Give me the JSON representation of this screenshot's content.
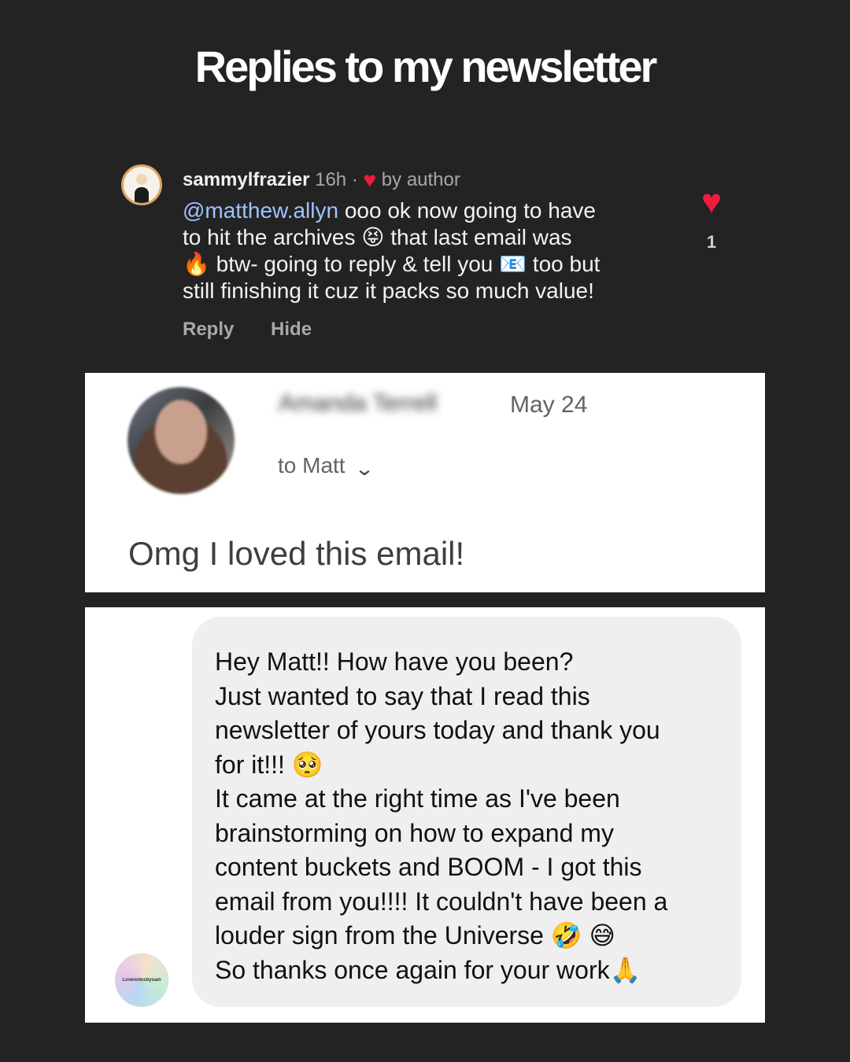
{
  "title": "Replies to my newsletter",
  "instagram_comment": {
    "username": "sammylfrazier",
    "time": "16h",
    "separator": "·",
    "liked_by_author": "by author",
    "mention": "@matthew.allyn",
    "text_lines": [
      " ooo ok now going to have",
      "to hit the archives 😝 that last email was",
      "🔥 btw- going to reply & tell you 📧 too but",
      "still finishing it cuz it packs so much value!"
    ],
    "reply_label": "Reply",
    "hide_label": "Hide",
    "like_count": "1",
    "heart_color": "#ed1c3e"
  },
  "email": {
    "sender_name": "Amanda Terrell",
    "date": "May 24",
    "to": "to Matt",
    "body": "Omg I loved this email!"
  },
  "dm": {
    "avatar_label": "Lovenotesbysam",
    "lines": [
      "Hey Matt!! How have you been?",
      "Just wanted to say that I read this",
      "newsletter of yours today and thank you",
      "for it!!! 🥺",
      "It came at the right time as I've been",
      "brainstorming on how to expand my",
      "content buckets and BOOM - I got this",
      "email from you!!!! It couldn't have been a",
      "louder sign from the Universe 🤣 😅",
      "So thanks once again for your work🙏"
    ]
  }
}
